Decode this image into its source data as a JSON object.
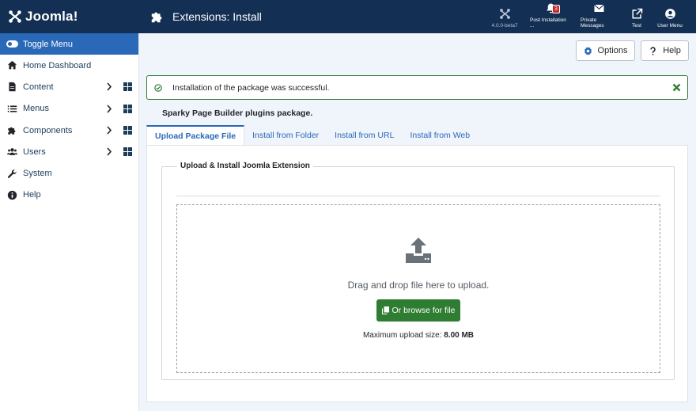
{
  "header": {
    "brand": "Joomla!",
    "page_title": "Extensions: Install",
    "items": [
      {
        "label": "4.0.0-beta7",
        "icon": "joomla-icon"
      },
      {
        "label": "Post Installation ...",
        "icon": "bell-icon",
        "badge": "3"
      },
      {
        "label": "Private Messages",
        "icon": "envelope-icon"
      },
      {
        "label": "Test",
        "icon": "external-link-icon"
      },
      {
        "label": "User Menu",
        "icon": "user-circle-icon"
      }
    ]
  },
  "sidebar": {
    "toggle_label": "Toggle Menu",
    "items": [
      {
        "label": "Home Dashboard",
        "icon": "home-icon"
      },
      {
        "label": "Content",
        "icon": "file-icon"
      },
      {
        "label": "Menus",
        "icon": "list-icon"
      },
      {
        "label": "Components",
        "icon": "puzzle-icon"
      },
      {
        "label": "Users",
        "icon": "users-icon"
      },
      {
        "label": "System",
        "icon": "wrench-icon"
      },
      {
        "label": "Help",
        "icon": "info-icon"
      }
    ]
  },
  "toolbar": {
    "options_label": "Options",
    "help_label": "Help"
  },
  "alert": {
    "message": "Installation of the package was successful."
  },
  "package_title": "Sparky Page Builder plugins package.",
  "tabs": [
    "Upload Package File",
    "Install from Folder",
    "Install from URL",
    "Install from Web"
  ],
  "upload": {
    "legend": "Upload & Install Joomla Extension",
    "drop_text": "Drag and drop file here to upload.",
    "browse_label": "Or browse for file",
    "max_label": "Maximum upload size: ",
    "max_value": "8.00 MB"
  },
  "colors": {
    "header_bg": "#132f53",
    "accent": "#2a69b8",
    "success": "#2f7d32",
    "badge": "#c52827"
  }
}
